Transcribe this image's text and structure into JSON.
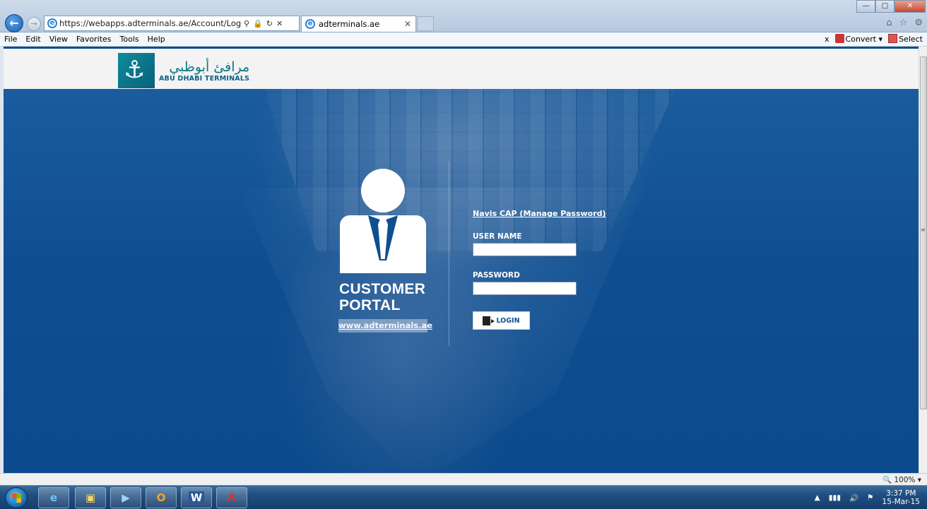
{
  "browser": {
    "address_url": "https://webapps.adterminals.ae/Account/Login.aspx?Retur",
    "tab_title": "adterminals.ae",
    "menu": [
      "File",
      "Edit",
      "View",
      "Favorites",
      "Tools",
      "Help"
    ],
    "toolbar_close": "x",
    "convert_label": "Convert",
    "select_label": "Select",
    "zoom_level": "100%"
  },
  "logo": {
    "arabic": "مرافئ أبوظبي",
    "english": "ABU DHABI TERMINALS"
  },
  "portal": {
    "title_line1": "CUSTOMER",
    "title_line2": "PORTAL",
    "website_link": "www.adterminals.ae"
  },
  "login_form": {
    "navis_link": "Navis CAP (Manage Password)",
    "username_label": "USER NAME",
    "username_value": "",
    "password_label": "PASSWORD",
    "password_value": "",
    "login_button": "LOGIN"
  },
  "taskbar": {
    "apps": [
      "ie-icon",
      "explorer-icon",
      "folder-icon",
      "outlook-icon",
      "word-icon",
      "acrobat-icon"
    ],
    "clock_time": "3:37 PM",
    "clock_date": "15-Mar-15"
  },
  "colors": {
    "hero_blue": "#0f4e91",
    "logo_teal": "#0c7a8a",
    "link_white": "#ffffff"
  }
}
